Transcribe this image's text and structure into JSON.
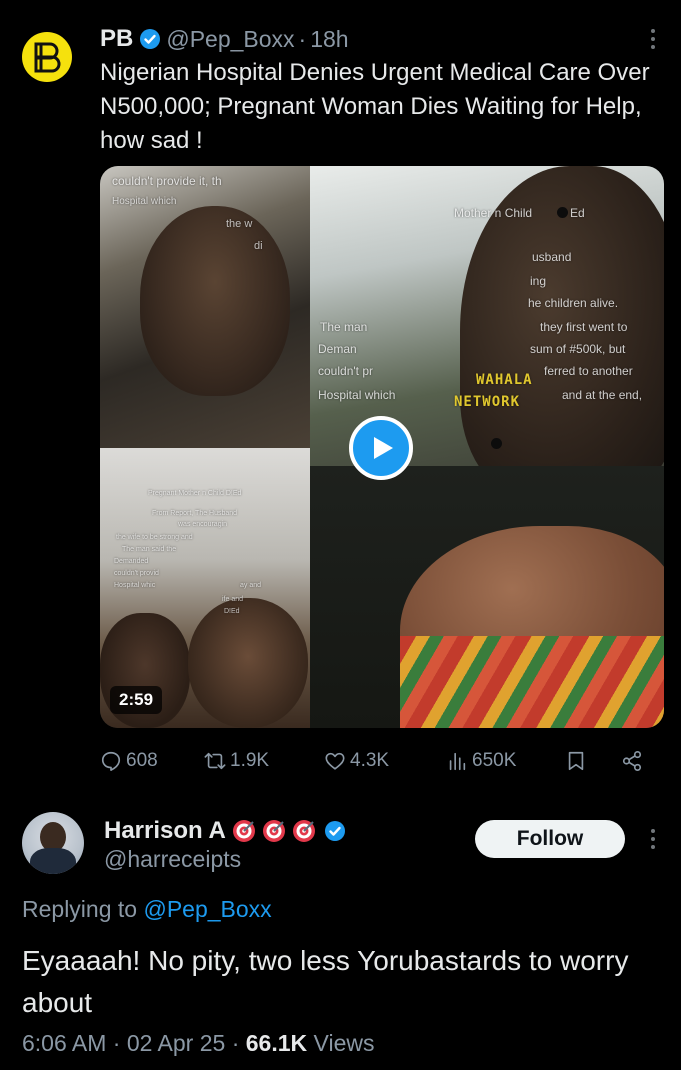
{
  "tweet1": {
    "avatar_logo": "PB",
    "author_name": "PB",
    "verified_icon": "verified-badge-icon",
    "handle": "@Pep_Boxx",
    "separator": "·",
    "time": "18h",
    "text": "Nigerian Hospital Denies Urgent Medical Care Over N500,000; Pregnant Woman Dies Waiting for Help, how sad !",
    "media": {
      "type": "video",
      "duration": "2:59",
      "overlay_text": {
        "a1": "couldn't provide it, th",
        "a2": "Hospital which",
        "a3": "the w",
        "a4": "di",
        "b1": "Pregnant Mother n Child D!Ed",
        "b2": "From Report, The Husband",
        "b3": "was encouragin",
        "b4": "the wife to be strong and",
        "b5": "The man said the",
        "b6": "Demanded",
        "b7": "couldn't provid",
        "b8": "Hospital whic",
        "b9": "ay and",
        "b10": "ife and",
        "b11": "D!Ed",
        "c1": "Mother n Child",
        "c2": "Ed",
        "c3": "usband",
        "c4": "ing",
        "c5": "he children alive.",
        "c6": "The man",
        "c7": "they first went to",
        "c8": "Deman",
        "c9": "sum of #500k, but",
        "c10": "couldn't pr",
        "c11": "ferred to another",
        "c12": "Hospital which",
        "c13": "and at the end,",
        "watermark1": "WAHALA",
        "watermark2": "NETWORK"
      }
    },
    "actions": {
      "replies": "608",
      "reposts": "1.9K",
      "likes": "4.3K",
      "views": "650K"
    }
  },
  "tweet2": {
    "author_name": "Harrison A",
    "emojis": [
      "target-emoji-icon",
      "target-emoji-icon",
      "target-emoji-icon"
    ],
    "verified_icon": "verified-badge-icon",
    "handle": "@harreceipts",
    "follow_label": "Follow",
    "replying_prefix": "Replying to",
    "replying_mention": "@Pep_Boxx",
    "text": "Eyaaaah! No pity, two less Yorubastards to worry about",
    "time": "6:06 AM",
    "sep1": "·",
    "date": "02 Apr 25",
    "sep2": "·",
    "view_count": "66.1K",
    "views_label": "Views"
  },
  "colors": {
    "background": "#000000",
    "text": "#e7e9ea",
    "secondary": "#8b98a5",
    "accent": "#1d9bf0",
    "avatar_yellow": "#f5e10d"
  }
}
